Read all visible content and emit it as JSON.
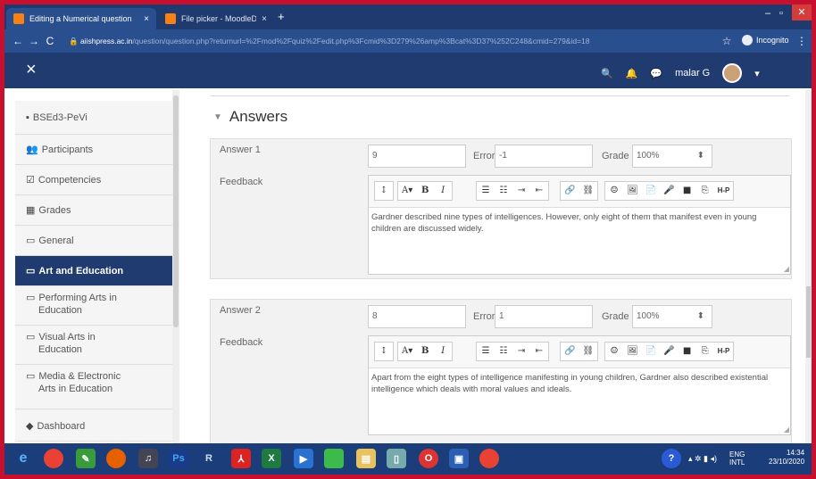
{
  "browser": {
    "tabs": [
      {
        "title": "Editing a Numerical question",
        "close": "×"
      },
      {
        "title": "File picker - MoodleDocs",
        "close": "×"
      }
    ],
    "new_tab": "+",
    "url_host": "aiishpress.ac.in",
    "url_path": "/question/question.php?returnurl=%2Fmod%2Fquiz%2Fedit.php%3Fcmid%3D279%26amp%3Bcat%3D37%252C248&cmid=279&id=18",
    "incognito_label": "Incognito"
  },
  "navbar": {
    "close_glyph": "×",
    "user_name": "malar G"
  },
  "sidebar": {
    "items": [
      {
        "icon": "▪",
        "label": "BSEd3-PeVi"
      },
      {
        "icon": "👥",
        "label": "Participants"
      },
      {
        "icon": "☑",
        "label": "Competencies"
      },
      {
        "icon": "▦",
        "label": "Grades"
      },
      {
        "icon": "▭",
        "label": "General"
      },
      {
        "icon": "▭",
        "label": "Art and Education"
      },
      {
        "icon": "▭",
        "label": "Performing Arts in",
        "label2": "Education"
      },
      {
        "icon": "▭",
        "label": "Visual Arts in",
        "label2": "Education"
      },
      {
        "icon": "▭",
        "label": "Media & Electronic",
        "label2": "Arts in Education"
      },
      {
        "icon": "◆",
        "label": "Dashboard"
      }
    ]
  },
  "section": {
    "caret": "▼",
    "title": "Answers"
  },
  "answers": [
    {
      "label": "Answer 1",
      "answer_value": "9",
      "error_label": "Error",
      "error_value": "-1",
      "grade_label": "Grade",
      "grade_value": "100%",
      "feedback_label": "Feedback",
      "feedback_text": "Gardner described nine types of intelligences. However, only eight of them that manifest even in young children are discussed widely."
    },
    {
      "label": "Answer 2",
      "answer_value": "8",
      "error_label": "Error",
      "error_value": "1",
      "grade_label": "Grade",
      "grade_value": "100%",
      "feedback_label": "Feedback",
      "feedback_text": "Apart from the eight types of intelligence manifesting in young children, Gardner also described existential intelligence which deals with moral values and ideals."
    }
  ],
  "toolbar": {
    "g1": [
      "↕"
    ],
    "g2": [
      "A▾",
      "B",
      "I"
    ],
    "g3": [
      "☰",
      "☷",
      "⇥",
      "⇤"
    ],
    "g4": [
      "🔗",
      "⛓"
    ],
    "g5": [
      "☺",
      "🖼",
      "📄",
      "🎤",
      "■",
      "⎘",
      "H-P"
    ]
  },
  "taskbar": {
    "lang": "ENG",
    "layout": "INTL",
    "time": "14:34",
    "date": "23/10/2020"
  }
}
